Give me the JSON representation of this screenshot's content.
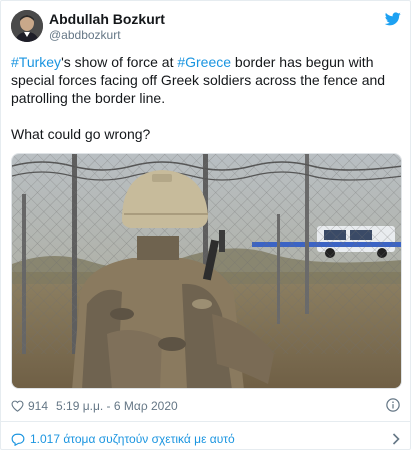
{
  "author": {
    "name": "Abdullah Bozkurt",
    "handle": "@abdbozkurt"
  },
  "tweet": {
    "line1_hashtag1": "#Turkey",
    "line1_text1": "'s show of force at ",
    "line1_hashtag2": "#Greece",
    "line1_text2": " border has begun with special forces facing off Greek soldiers across the fence and patrolling the border line.",
    "line2": "What could go wrong?"
  },
  "stats": {
    "likes": "914",
    "timestamp": "5:19 μ.μ. - 6 Μαρ 2020"
  },
  "footer": {
    "conversation": "1.017 άτομα συζητούν σχετικά με αυτό"
  },
  "icons": {
    "brand": "twitter-bird-icon",
    "like": "heart-icon",
    "info": "info-icon",
    "reply": "speech-bubble-icon",
    "more": "chevron-right-icon"
  },
  "colors": {
    "link": "#1b95e0",
    "secondary_text": "#657786",
    "primary_text": "#14171a"
  }
}
